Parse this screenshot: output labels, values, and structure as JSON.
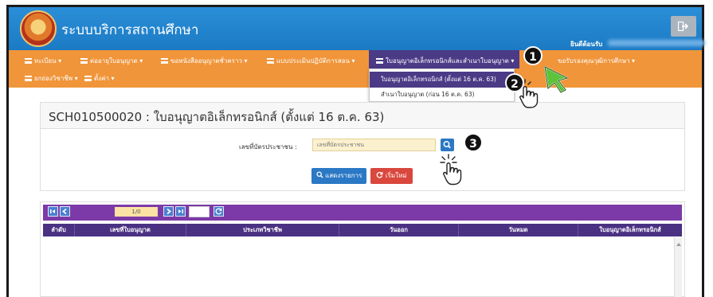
{
  "header": {
    "app_title": "ระบบบริการสถานศึกษา",
    "welcome": "ยินดีต้อนรับ"
  },
  "menu": {
    "items": [
      "ทะเบียน",
      "ต่ออายุใบอนุญาต",
      "ขอหนังสืออนุญาตชั่วคราว",
      "แบบประเมินปฏิบัติการสอน",
      "ใบอนุญาตอิเล็กทรอนิกส์และสำเนาใบอนุญาต",
      "ขอรับรองคุณวุฒิการศึกษา",
      "ยกย่องวิชาชีพ",
      "ตั้งค่า"
    ],
    "dropdown": [
      "ใบอนุญาตอิเล็กทรอนิกส์ (ตั้งแต่ 16 ต.ค. 63)",
      "สำเนาใบอนุญาต (ก่อน 16 ต.ค. 63)"
    ]
  },
  "steps": [
    "1",
    "2",
    "3"
  ],
  "page": {
    "title": "SCH010500020 : ใบอนุญาตอิเล็กทรอนิกส์ (ตั้งแต่ 16 ต.ค. 63)"
  },
  "form": {
    "id_label": "เลขที่บัตรประชาชน :",
    "id_placeholder": "เลขที่บัตรประชาชน",
    "show_label": "แสดงรายการ",
    "reset_label": "เริ่มใหม่"
  },
  "pager": {
    "info": "1/0"
  },
  "table": {
    "columns": [
      "ลำดับ",
      "เลขที่ใบอนุญาต",
      "ประเภทวิชาชีพ",
      "วันออก",
      "วันหมด",
      "ใบอนุญาตอิเล็กทรอนิกส์"
    ]
  },
  "colors": {
    "header_blue": "#1c7ac4",
    "menu_orange": "#f0953a",
    "active_purple": "#4b3a86",
    "table_purple": "#7c3aa8"
  },
  "icons": [
    "logout-icon",
    "menu-list-icon",
    "search-icon",
    "refresh-icon",
    "hand-pointer-icon",
    "arrow-pointer-icon"
  ]
}
